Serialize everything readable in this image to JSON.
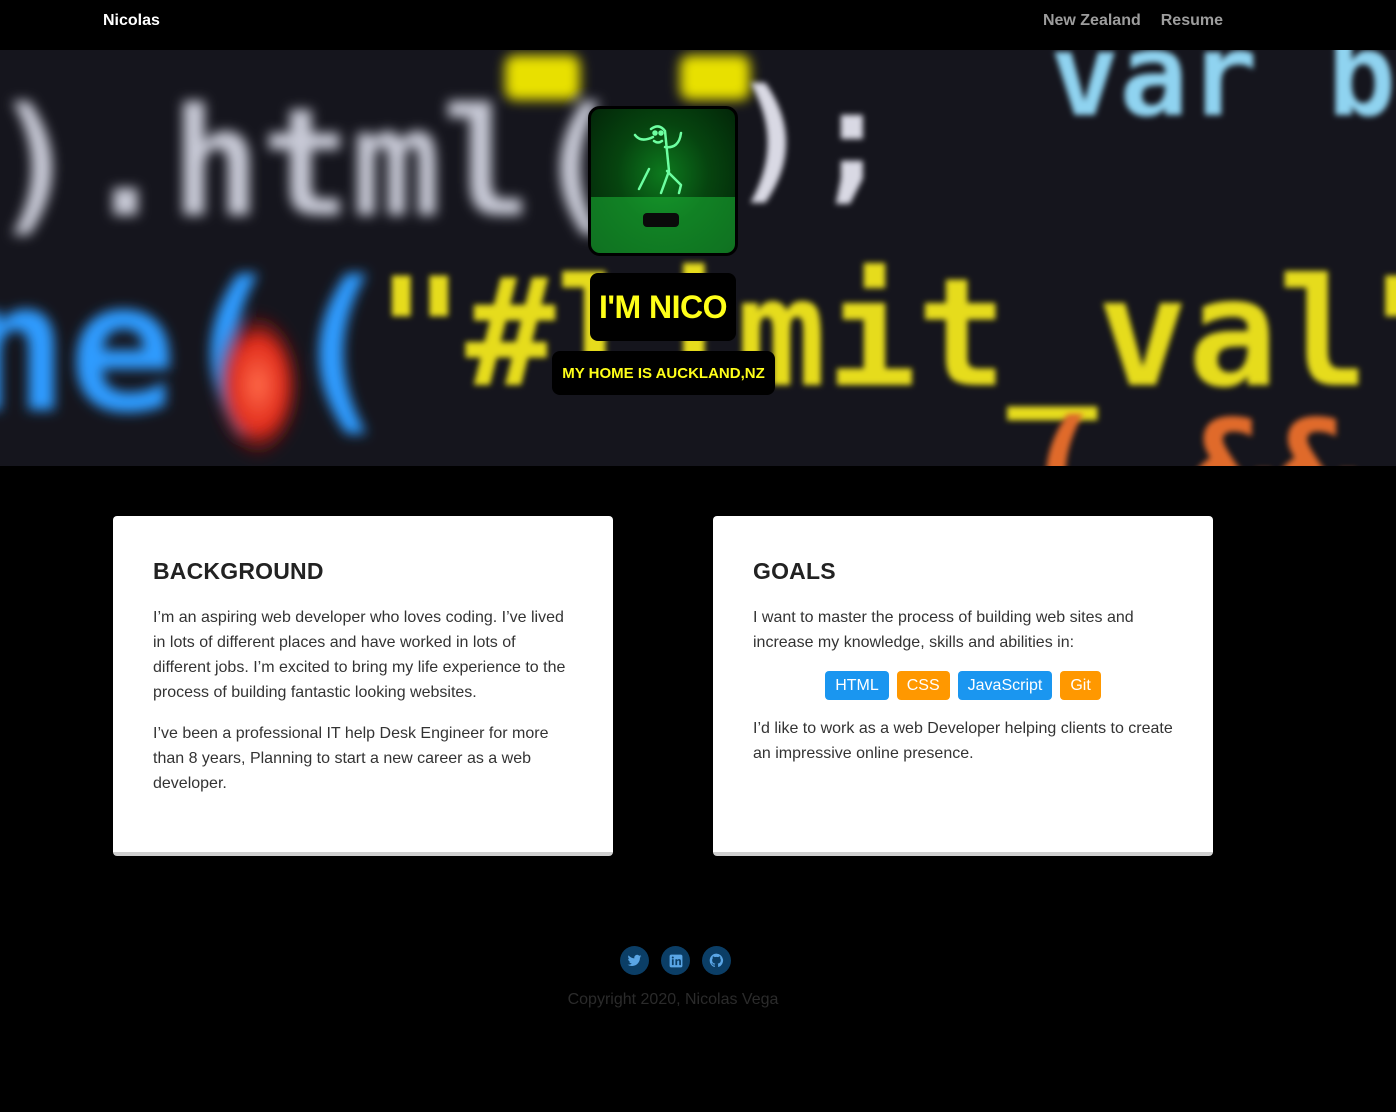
{
  "navbar": {
    "brand": "Nicolas",
    "links": [
      "New Zealand",
      "Resume"
    ]
  },
  "hero": {
    "title": "I'M NICO",
    "subtitle": "MY HOME IS AUCKLAND,NZ",
    "background_text": {
      "line1_left": ").html(",
      "line1_right": "var b",
      "line2_left": "ne((",
      "line2_mid": "\"#limit_val\").va",
      "line3": "( &&  (",
      "semicolon": ");"
    }
  },
  "background_card": {
    "title": "BACKGROUND",
    "paragraph1": "I’m an aspiring web developer who loves coding. I’ve lived in lots of different places and have worked in lots of different jobs. I’m excited to bring my life experience to the process of building fantastic looking websites.",
    "paragraph2": "I’ve been a professional IT help Desk Engineer for more than 8 years, Planning to start a new career as a web developer."
  },
  "goals_card": {
    "title": "GOALS",
    "paragraph1": "I want to master the process of building web sites and increase my knowledge, skills and abilities in:",
    "skills": [
      {
        "label": "HTML",
        "color": "#1a96f0"
      },
      {
        "label": "CSS",
        "color": "#ff9800"
      },
      {
        "label": "JavaScript",
        "color": "#1a96f0"
      },
      {
        "label": "Git",
        "color": "#ff9800"
      }
    ],
    "paragraph2": "I’d like to work as a web Developer helping clients to create an impressive online presence."
  },
  "footer": {
    "social": [
      "twitter-icon",
      "linkedin-icon",
      "github-icon"
    ],
    "copyright": "Copyright 2020, Nicolas Vega"
  },
  "colors": {
    "accent_yellow": "#ffff19",
    "skill_blue": "#1a96f0",
    "skill_orange": "#ff9800"
  }
}
